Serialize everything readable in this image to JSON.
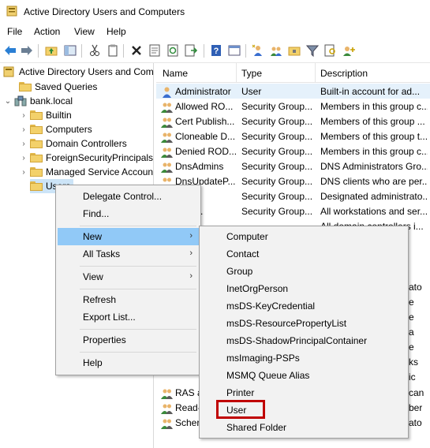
{
  "window": {
    "title": "Active Directory Users and Computers"
  },
  "menubar": {
    "items": [
      "File",
      "Action",
      "View",
      "Help"
    ]
  },
  "toolbar": {
    "buttons": [
      "back-icon",
      "forward-icon",
      "up-folder-icon",
      "show-tree-icon",
      "cut-icon",
      "copy-icon",
      "delete-icon",
      "properties-icon",
      "refresh-icon",
      "export-icon",
      "help-icon",
      "console-icon",
      "new-user-icon",
      "new-group-icon",
      "new-ou-icon",
      "filter-icon",
      "find-icon",
      "add-to-group-icon"
    ]
  },
  "tree": {
    "root": "Active Directory Users and Com",
    "saved_queries": "Saved Queries",
    "domain": "bank.local",
    "children": [
      "Builtin",
      "Computers",
      "Domain Controllers",
      "ForeignSecurityPrincipals",
      "Managed Service Accoun",
      "Users"
    ]
  },
  "list": {
    "columns": [
      "Name",
      "Type",
      "Description"
    ],
    "rows": [
      {
        "name": "Administrator",
        "type": "User",
        "description": "Built-in account for ad..."
      },
      {
        "name": "Allowed RO...",
        "type": "Security Group...",
        "description": "Members in this group c..."
      },
      {
        "name": "Cert Publish...",
        "type": "Security Group...",
        "description": "Members of this group ..."
      },
      {
        "name": "Cloneable D...",
        "type": "Security Group...",
        "description": "Members of this group t..."
      },
      {
        "name": "Denied ROD...",
        "type": "Security Group...",
        "description": "Members in this group c..."
      },
      {
        "name": "DnsAdmins",
        "type": "Security Group...",
        "description": "DNS Administrators Gro..."
      },
      {
        "name": "DnsUpdateP...",
        "type": "Security Group...",
        "description": "DNS clients who are per..."
      },
      {
        "name": "n Ad...",
        "type": "Security Group...",
        "description": "Designated administrato..."
      },
      {
        "name": "n Co...",
        "type": "Security Group...",
        "description": "All workstations and ser..."
      },
      {
        "name": "",
        "type": "",
        "description": "All domain controllers i..."
      }
    ],
    "partial_rows": [
      {
        "name": "RAS a",
        "desc_tail": "can"
      },
      {
        "name": "Read-",
        "desc_tail": "ber"
      },
      {
        "name": "Scher",
        "desc_tail": "ato"
      }
    ],
    "right_tails": [
      "ato",
      "e",
      "e",
      "a",
      "e",
      "ks",
      "ic"
    ]
  },
  "context_menu": {
    "items": [
      "Delegate Control...",
      "Find...",
      "New",
      "All Tasks",
      "View",
      "Refresh",
      "Export List...",
      "Properties",
      "Help"
    ]
  },
  "new_submenu": {
    "items": [
      "Computer",
      "Contact",
      "Group",
      "InetOrgPerson",
      "msDS-KeyCredential",
      "msDS-ResourcePropertyList",
      "msDS-ShadowPrincipalContainer",
      "msImaging-PSPs",
      "MSMQ Queue Alias",
      "Printer",
      "User",
      "Shared Folder"
    ],
    "highlighted": "User"
  },
  "colors": {
    "highlight": "#91c9f7",
    "callout": "#c00000",
    "menu_bg": "#f2f2f2"
  }
}
